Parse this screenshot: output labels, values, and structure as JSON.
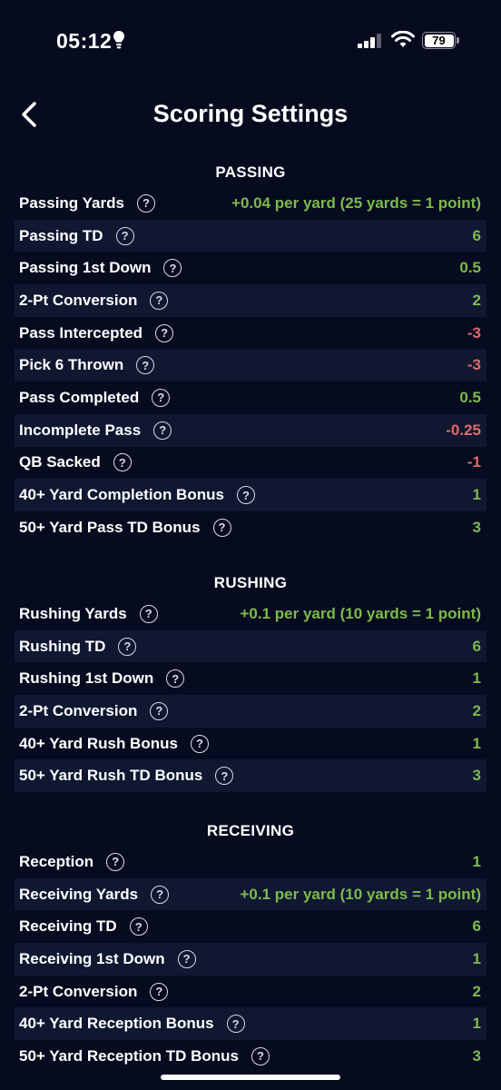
{
  "status": {
    "time": "05:12",
    "battery": "79"
  },
  "header": {
    "title": "Scoring Settings",
    "back_icon": "chevron-left-icon"
  },
  "colors": {
    "background": "#070b1f",
    "row_alt": "#0f1731",
    "positive": "#7dbb4c",
    "negative": "#e06b6b"
  },
  "sections": [
    {
      "title": "PASSING",
      "rows": [
        {
          "label": "Passing Yards",
          "value": "+0.04 per yard (25 yards = 1 point)",
          "sign": "pos"
        },
        {
          "label": "Passing TD",
          "value": "6",
          "sign": "pos"
        },
        {
          "label": "Passing 1st Down",
          "value": "0.5",
          "sign": "pos"
        },
        {
          "label": "2-Pt Conversion",
          "value": "2",
          "sign": "pos"
        },
        {
          "label": "Pass Intercepted",
          "value": "-3",
          "sign": "neg"
        },
        {
          "label": "Pick 6 Thrown",
          "value": "-3",
          "sign": "neg"
        },
        {
          "label": "Pass Completed",
          "value": "0.5",
          "sign": "pos"
        },
        {
          "label": "Incomplete Pass",
          "value": "-0.25",
          "sign": "neg"
        },
        {
          "label": "QB Sacked",
          "value": "-1",
          "sign": "neg"
        },
        {
          "label": "40+ Yard Completion Bonus",
          "value": "1",
          "sign": "pos"
        },
        {
          "label": "50+ Yard Pass TD Bonus",
          "value": "3",
          "sign": "pos"
        }
      ]
    },
    {
      "title": "RUSHING",
      "rows": [
        {
          "label": "Rushing Yards",
          "value": "+0.1 per yard (10 yards = 1 point)",
          "sign": "pos"
        },
        {
          "label": "Rushing TD",
          "value": "6",
          "sign": "pos"
        },
        {
          "label": "Rushing 1st Down",
          "value": "1",
          "sign": "pos"
        },
        {
          "label": "2-Pt Conversion",
          "value": "2",
          "sign": "pos"
        },
        {
          "label": "40+ Yard Rush Bonus",
          "value": "1",
          "sign": "pos"
        },
        {
          "label": "50+ Yard Rush TD Bonus",
          "value": "3",
          "sign": "pos"
        }
      ]
    },
    {
      "title": "RECEIVING",
      "rows": [
        {
          "label": "Reception",
          "value": "1",
          "sign": "pos"
        },
        {
          "label": "Receiving Yards",
          "value": "+0.1 per yard (10 yards = 1 point)",
          "sign": "pos"
        },
        {
          "label": "Receiving TD",
          "value": "6",
          "sign": "pos"
        },
        {
          "label": "Receiving 1st Down",
          "value": "1",
          "sign": "pos"
        },
        {
          "label": "2-Pt Conversion",
          "value": "2",
          "sign": "pos"
        },
        {
          "label": "40+ Yard Reception Bonus",
          "value": "1",
          "sign": "pos"
        },
        {
          "label": "50+ Yard Reception TD Bonus",
          "value": "3",
          "sign": "pos"
        }
      ]
    }
  ]
}
